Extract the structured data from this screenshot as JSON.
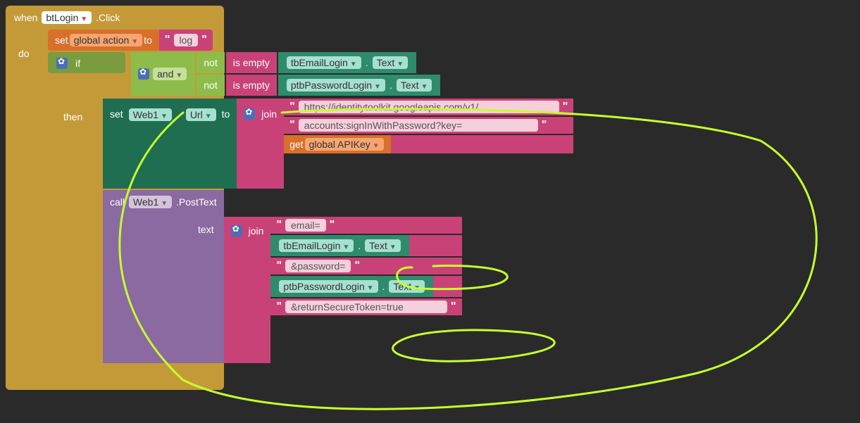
{
  "event": {
    "when": "when",
    "component": "btLogin",
    "event_name": ".Click",
    "do": "do"
  },
  "set_action": {
    "set": "set",
    "var": "global action",
    "to": "to",
    "value": "log"
  },
  "if_block": {
    "if": "if",
    "then": "then",
    "and": "and",
    "not1": "not",
    "not2": "not",
    "isempty1": "is empty",
    "isempty2": "is empty",
    "prop1_comp": "tbEmailLogin",
    "prop1_dot": ".",
    "prop1_prop": "Text",
    "prop2_comp": "ptbPasswordLogin",
    "prop2_dot": ".",
    "prop2_prop": "Text"
  },
  "set_web": {
    "set": "set",
    "comp": "Web1",
    "dot": ".",
    "prop": "Url",
    "to": "to",
    "join": "join",
    "url_part1": "https://identitytoolkit.googleapis.com/v1/",
    "url_part2": "accounts:signInWithPassword?key=",
    "get": "get",
    "apikey": "global APIKey"
  },
  "call_web": {
    "call": "call",
    "comp": "Web1",
    "method": ".PostText",
    "text_label": "text",
    "join": "join",
    "arg1": "email=",
    "arg2_comp": "tbEmailLogin",
    "arg2_dot": ".",
    "arg2_prop": "Text",
    "arg3": "&password=",
    "arg4_comp": "ptbPasswordLogin",
    "arg4_dot": ".",
    "arg4_prop": "Text",
    "arg5": "&returnSecureToken=true"
  }
}
